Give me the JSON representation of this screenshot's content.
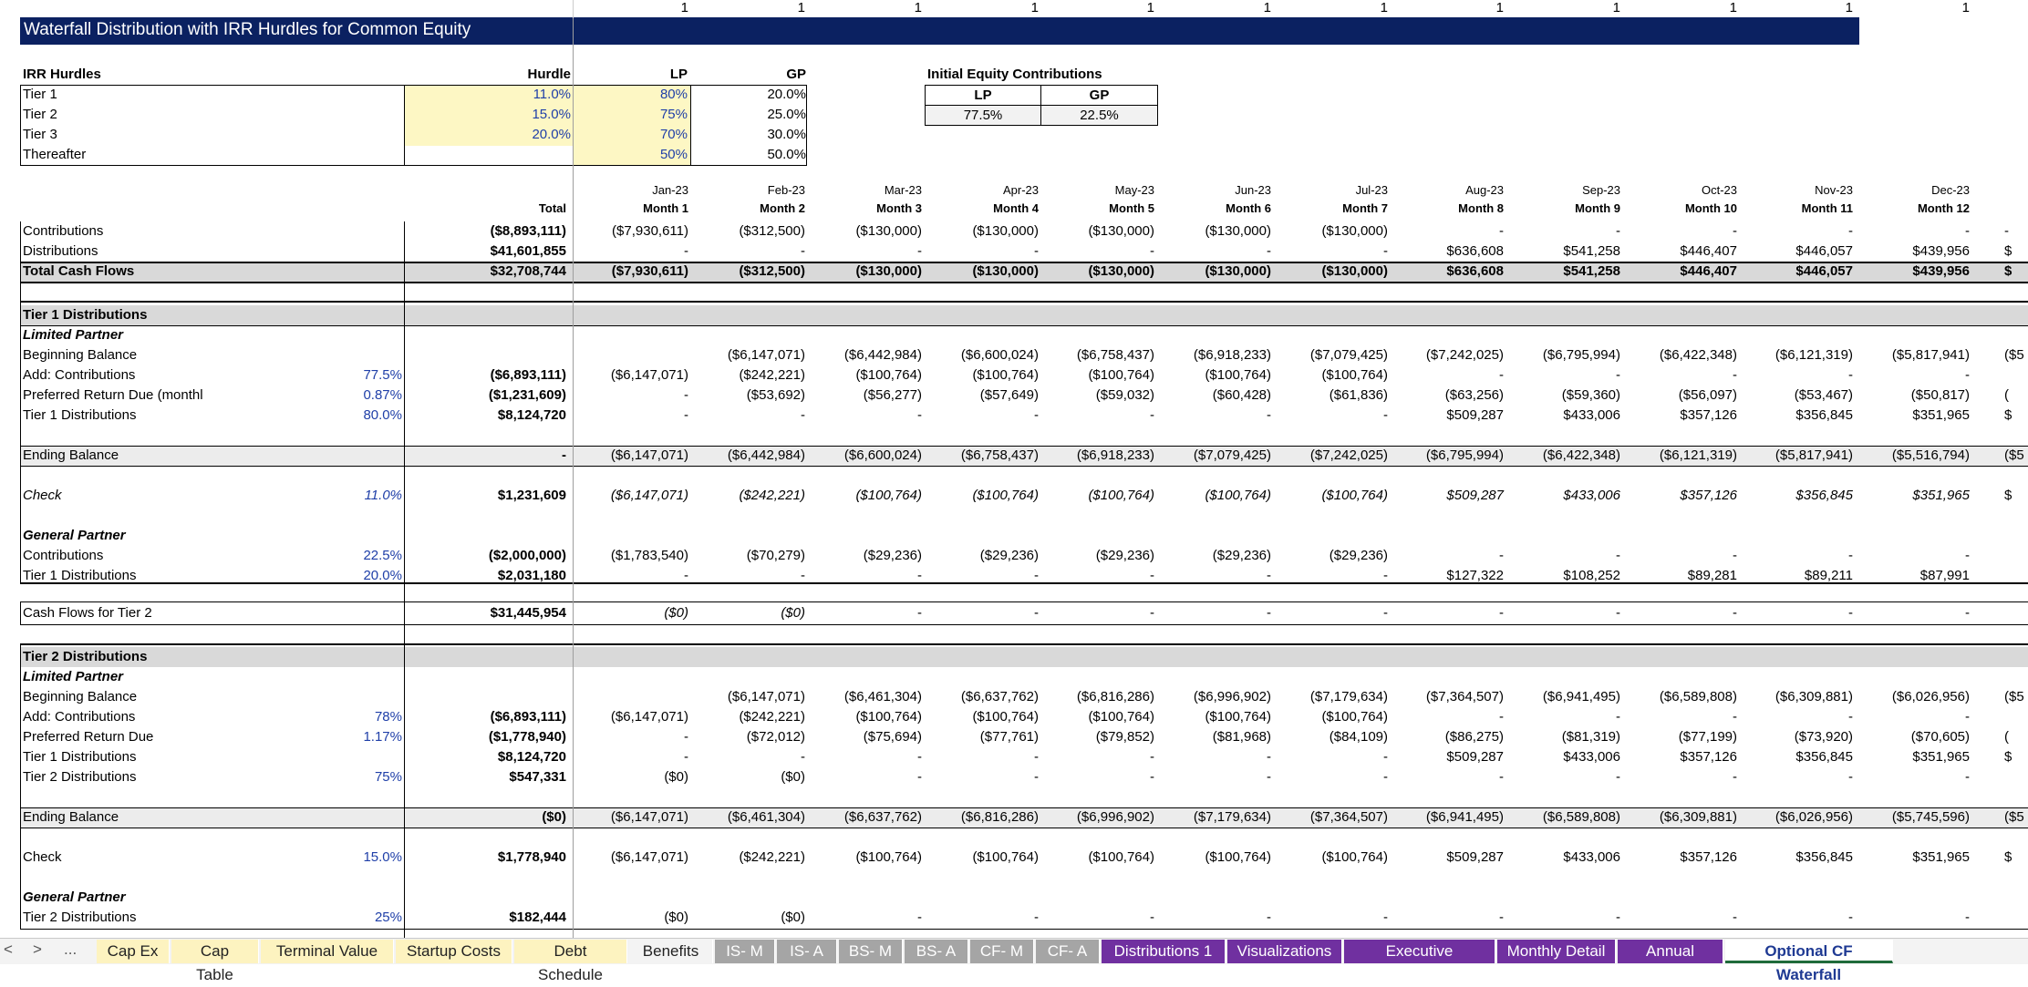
{
  "title": "Waterfall Distribution with IRR Hurdles for Common Equity",
  "top_counters": [
    "1",
    "1",
    "1",
    "1",
    "1",
    "1",
    "1",
    "1",
    "1",
    "1",
    "1",
    "1"
  ],
  "irr": {
    "header": {
      "label": "IRR Hurdles",
      "hurdle": "Hurdle",
      "lp": "LP",
      "gp": "GP"
    },
    "rows": [
      {
        "label": "Tier 1",
        "hurdle": "11.0%",
        "lp": "80%",
        "gp": "20.0%"
      },
      {
        "label": "Tier 2",
        "hurdle": "15.0%",
        "lp": "75%",
        "gp": "25.0%"
      },
      {
        "label": "Tier 3",
        "hurdle": "20.0%",
        "lp": "70%",
        "gp": "30.0%"
      },
      {
        "label": "Thereafter",
        "hurdle": "",
        "lp": "50%",
        "gp": "50.0%"
      }
    ]
  },
  "initial_equity": {
    "title": "Initial Equity Contributions",
    "lp_label": "LP",
    "gp_label": "GP",
    "lp": "77.5%",
    "gp": "22.5%"
  },
  "columns": {
    "total_label": "Total",
    "dates": [
      "Jan-23",
      "Feb-23",
      "Mar-23",
      "Apr-23",
      "May-23",
      "Jun-23",
      "Jul-23",
      "Aug-23",
      "Sep-23",
      "Oct-23",
      "Nov-23",
      "Dec-23"
    ],
    "months": [
      "Month 1",
      "Month 2",
      "Month 3",
      "Month 4",
      "Month 5",
      "Month 6",
      "Month 7",
      "Month 8",
      "Month 9",
      "Month 10",
      "Month 11",
      "Month 12"
    ]
  },
  "rows": [
    {
      "label": "Contributions",
      "pct": "",
      "total": "($8,893,111)",
      "vals": [
        "($7,930,611)",
        "($312,500)",
        "($130,000)",
        "($130,000)",
        "($130,000)",
        "($130,000)",
        "($130,000)",
        "-",
        "-",
        "-",
        "-",
        "-"
      ],
      "edge": "-"
    },
    {
      "label": "Distributions",
      "pct": "",
      "total": "$41,601,855",
      "vals": [
        "-",
        "-",
        "-",
        "-",
        "-",
        "-",
        "-",
        "$636,608",
        "$541,258",
        "$446,407",
        "$446,057",
        "$439,956"
      ],
      "edge": "$"
    },
    {
      "label": "Total Cash Flows",
      "pct": "",
      "total": "$32,708,744",
      "vals": [
        "($7,930,611)",
        "($312,500)",
        "($130,000)",
        "($130,000)",
        "($130,000)",
        "($130,000)",
        "($130,000)",
        "$636,608",
        "$541,258",
        "$446,407",
        "$446,057",
        "$439,956"
      ],
      "edge": "$"
    },
    {
      "label": "Tier 1 Distributions",
      "pct": "",
      "total": "",
      "vals": [
        "",
        "",
        "",
        "",
        "",
        "",
        "",
        "",
        "",
        "",
        "",
        ""
      ],
      "edge": ""
    },
    {
      "label": "Limited Partner",
      "pct": "",
      "total": "",
      "vals": [
        "",
        "",
        "",
        "",
        "",
        "",
        "",
        "",
        "",
        "",
        "",
        ""
      ],
      "edge": ""
    },
    {
      "label": "Beginning Balance",
      "pct": "",
      "total": "",
      "vals": [
        "",
        "($6,147,071)",
        "($6,442,984)",
        "($6,600,024)",
        "($6,758,437)",
        "($6,918,233)",
        "($7,079,425)",
        "($7,242,025)",
        "($6,795,994)",
        "($6,422,348)",
        "($6,121,319)",
        "($5,817,941)"
      ],
      "edge": "($5"
    },
    {
      "label": "Add: Contributions",
      "pct": "77.5%",
      "total": "($6,893,111)",
      "vals": [
        "($6,147,071)",
        "($242,221)",
        "($100,764)",
        "($100,764)",
        "($100,764)",
        "($100,764)",
        "($100,764)",
        "-",
        "-",
        "-",
        "-",
        "-"
      ],
      "edge": ""
    },
    {
      "label": "Preferred Return Due (monthl",
      "pct": "0.87%",
      "total": "($1,231,609)",
      "vals": [
        "-",
        "($53,692)",
        "($56,277)",
        "($57,649)",
        "($59,032)",
        "($60,428)",
        "($61,836)",
        "($63,256)",
        "($59,360)",
        "($56,097)",
        "($53,467)",
        "($50,817)"
      ],
      "edge": "("
    },
    {
      "label": "Tier 1 Distributions",
      "pct": "80.0%",
      "total": "$8,124,720",
      "vals": [
        "-",
        "-",
        "-",
        "-",
        "-",
        "-",
        "-",
        "$509,287",
        "$433,006",
        "$357,126",
        "$356,845",
        "$351,965"
      ],
      "edge": "$"
    },
    {
      "label": "Ending Balance",
      "pct": "",
      "total": "-",
      "vals": [
        "($6,147,071)",
        "($6,442,984)",
        "($6,600,024)",
        "($6,758,437)",
        "($6,918,233)",
        "($7,079,425)",
        "($7,242,025)",
        "($6,795,994)",
        "($6,422,348)",
        "($6,121,319)",
        "($5,817,941)",
        "($5,516,794)"
      ],
      "edge": "($5"
    },
    {
      "label": "Check",
      "pct": "11.0%",
      "total": "$1,231,609",
      "vals": [
        "($6,147,071)",
        "($242,221)",
        "($100,764)",
        "($100,764)",
        "($100,764)",
        "($100,764)",
        "($100,764)",
        "$509,287",
        "$433,006",
        "$357,126",
        "$356,845",
        "$351,965"
      ],
      "edge": "$"
    },
    {
      "label": "General Partner",
      "pct": "",
      "total": "",
      "vals": [
        "",
        "",
        "",
        "",
        "",
        "",
        "",
        "",
        "",
        "",
        "",
        ""
      ],
      "edge": ""
    },
    {
      "label": "Contributions",
      "pct": "22.5%",
      "total": "($2,000,000)",
      "vals": [
        "($1,783,540)",
        "($70,279)",
        "($29,236)",
        "($29,236)",
        "($29,236)",
        "($29,236)",
        "($29,236)",
        "-",
        "-",
        "-",
        "-",
        "-"
      ],
      "edge": ""
    },
    {
      "label": "Tier 1 Distributions",
      "pct": "20.0%",
      "total": "$2,031,180",
      "vals": [
        "-",
        "-",
        "-",
        "-",
        "-",
        "-",
        "-",
        "$127,322",
        "$108,252",
        "$89,281",
        "$89,211",
        "$87,991"
      ],
      "edge": ""
    },
    {
      "label": "Cash Flows for Tier 2",
      "pct": "",
      "total": "$31,445,954",
      "vals": [
        "($0)",
        "($0)",
        "-",
        "-",
        "-",
        "-",
        "-",
        "-",
        "-",
        "-",
        "-",
        "-"
      ],
      "edge": ""
    },
    {
      "label": "Tier 2 Distributions",
      "pct": "",
      "total": "",
      "vals": [
        "",
        "",
        "",
        "",
        "",
        "",
        "",
        "",
        "",
        "",
        "",
        ""
      ],
      "edge": ""
    },
    {
      "label": "Limited Partner",
      "pct": "",
      "total": "",
      "vals": [
        "",
        "",
        "",
        "",
        "",
        "",
        "",
        "",
        "",
        "",
        "",
        ""
      ],
      "edge": ""
    },
    {
      "label": "Beginning Balance",
      "pct": "",
      "total": "",
      "vals": [
        "",
        "($6,147,071)",
        "($6,461,304)",
        "($6,637,762)",
        "($6,816,286)",
        "($6,996,902)",
        "($7,179,634)",
        "($7,364,507)",
        "($6,941,495)",
        "($6,589,808)",
        "($6,309,881)",
        "($6,026,956)"
      ],
      "edge": "($5"
    },
    {
      "label": "Add: Contributions",
      "pct": "78%",
      "total": "($6,893,111)",
      "vals": [
        "($6,147,071)",
        "($242,221)",
        "($100,764)",
        "($100,764)",
        "($100,764)",
        "($100,764)",
        "($100,764)",
        "-",
        "-",
        "-",
        "-",
        "-"
      ],
      "edge": ""
    },
    {
      "label": "Preferred Return Due",
      "pct": "1.17%",
      "total": "($1,778,940)",
      "vals": [
        "-",
        "($72,012)",
        "($75,694)",
        "($77,761)",
        "($79,852)",
        "($81,968)",
        "($84,109)",
        "($86,275)",
        "($81,319)",
        "($77,199)",
        "($73,920)",
        "($70,605)"
      ],
      "edge": "("
    },
    {
      "label": "Tier 1 Distributions",
      "pct": "",
      "total": "$8,124,720",
      "vals": [
        "-",
        "-",
        "-",
        "-",
        "-",
        "-",
        "-",
        "$509,287",
        "$433,006",
        "$357,126",
        "$356,845",
        "$351,965"
      ],
      "edge": "$"
    },
    {
      "label": "Tier 2 Distributions",
      "pct": "75%",
      "total": "$547,331",
      "vals": [
        "($0)",
        "($0)",
        "-",
        "-",
        "-",
        "-",
        "-",
        "-",
        "-",
        "-",
        "-",
        "-"
      ],
      "edge": ""
    },
    {
      "label": "Ending Balance",
      "pct": "",
      "total": "($0)",
      "vals": [
        "($6,147,071)",
        "($6,461,304)",
        "($6,637,762)",
        "($6,816,286)",
        "($6,996,902)",
        "($7,179,634)",
        "($7,364,507)",
        "($6,941,495)",
        "($6,589,808)",
        "($6,309,881)",
        "($6,026,956)",
        "($5,745,596)"
      ],
      "edge": "($5"
    },
    {
      "label": "Check",
      "pct": "15.0%",
      "total": "$1,778,940",
      "vals": [
        "($6,147,071)",
        "($242,221)",
        "($100,764)",
        "($100,764)",
        "($100,764)",
        "($100,764)",
        "($100,764)",
        "$509,287",
        "$433,006",
        "$357,126",
        "$356,845",
        "$351,965"
      ],
      "edge": "$"
    },
    {
      "label": "General Partner",
      "pct": "",
      "total": "",
      "vals": [
        "",
        "",
        "",
        "",
        "",
        "",
        "",
        "",
        "",
        "",
        "",
        ""
      ],
      "edge": ""
    },
    {
      "label": "Tier 2 Distributions",
      "pct": "25%",
      "total": "$182,444",
      "vals": [
        "($0)",
        "($0)",
        "-",
        "-",
        "-",
        "-",
        "-",
        "-",
        "-",
        "-",
        "-",
        "-"
      ],
      "edge": ""
    }
  ],
  "tabs": {
    "nav": [
      "<",
      ">",
      "..."
    ],
    "items": [
      {
        "label": "Cap Ex",
        "style": "y"
      },
      {
        "label": "Cap Table",
        "style": "y"
      },
      {
        "label": "Terminal Value",
        "style": "y"
      },
      {
        "label": "Startup Costs",
        "style": "y"
      },
      {
        "label": "Debt Schedule",
        "style": "y"
      },
      {
        "label": "Benefits",
        "style": "w"
      },
      {
        "label": "IS- M",
        "style": "g"
      },
      {
        "label": "IS- A",
        "style": "g"
      },
      {
        "label": "BS- M",
        "style": "g"
      },
      {
        "label": "BS- A",
        "style": "g"
      },
      {
        "label": "CF- M",
        "style": "g"
      },
      {
        "label": "CF- A",
        "style": "g"
      },
      {
        "label": "Distributions 1",
        "style": "p"
      },
      {
        "label": "Visualizations",
        "style": "p"
      },
      {
        "label": "Executive Summary",
        "style": "p"
      },
      {
        "label": "Monthly Detail",
        "style": "p"
      },
      {
        "label": "Annual Detail",
        "style": "p"
      },
      {
        "label": "Optional CF Waterfall",
        "style": "active"
      }
    ]
  },
  "colors": {
    "title_bar": "#0b2161",
    "band": "#d9d9d9",
    "input_fill": "#fdf7c4",
    "input_text": "#1f3fa8",
    "tab_purple": "#7030a0",
    "tab_gray": "#a5a5a5",
    "tab_yellow": "#fdf3c0"
  }
}
